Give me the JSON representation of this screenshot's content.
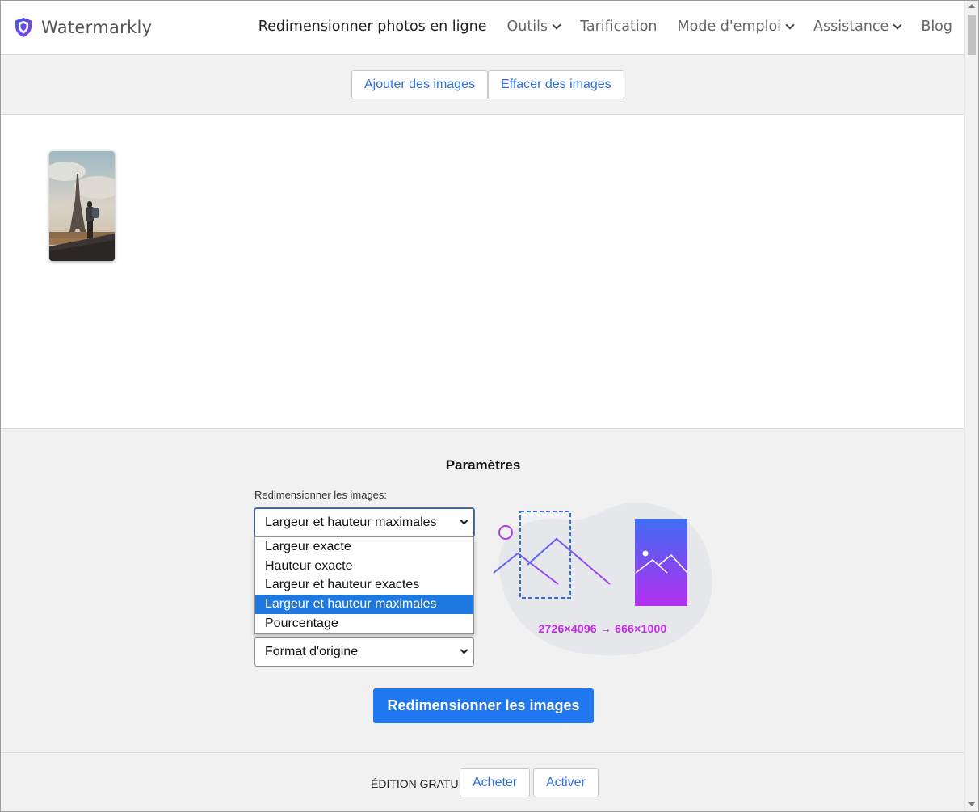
{
  "header": {
    "brand": "Watermarkly",
    "nav": [
      {
        "label": "Redimensionner photos en ligne",
        "dropdown": false,
        "active": true
      },
      {
        "label": "Outils",
        "dropdown": true
      },
      {
        "label": "Tarification",
        "dropdown": false
      },
      {
        "label": "Mode d'emploi",
        "dropdown": true
      },
      {
        "label": "Assistance",
        "dropdown": true
      },
      {
        "label": "Blog",
        "dropdown": false
      }
    ]
  },
  "toolbar": {
    "add_label": "Ajouter des images",
    "clear_label": "Effacer des images"
  },
  "params": {
    "title": "Paramètres",
    "resize_label": "Redimensionner les images:",
    "resize_value": "Largeur et hauteur maximales",
    "resize_options": [
      "Largeur exacte",
      "Hauteur exacte",
      "Largeur et hauteur exactes",
      "Largeur et hauteur maximales",
      "Pourcentage"
    ],
    "selected_option_index": 3,
    "format_value": "Format d'origine",
    "dimensions": "2726×4096 → 666×1000",
    "submit_label": "Redimensionner les images"
  },
  "footer": {
    "edition": "ÉDITION GRATUIT",
    "buy_label": "Acheter",
    "activate_label": "Activer"
  },
  "colors": {
    "accent": "#1f78ef",
    "link": "#2f6fe0",
    "highlight": "#c425e8",
    "logo": "#5b3fd8"
  },
  "icons": [
    "shield-logo-icon",
    "chevron-down-icon",
    "select-arrow-icon",
    "resize-illustration"
  ]
}
